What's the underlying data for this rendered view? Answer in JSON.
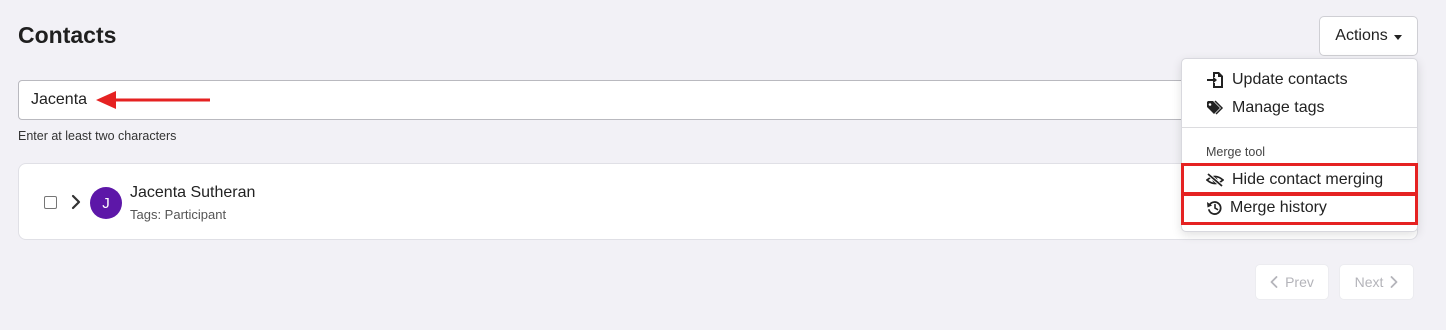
{
  "page": {
    "title": "Contacts"
  },
  "actions": {
    "label": "Actions"
  },
  "search": {
    "value": "Jacenta",
    "hint": "Enter at least two characters"
  },
  "results": [
    {
      "initial": "J",
      "name": "Jacenta Sutheran",
      "tags": "Tags: Participant"
    }
  ],
  "pagination": {
    "prev": "Prev",
    "next": "Next"
  },
  "dropdown": {
    "items": [
      {
        "label": "Update contacts",
        "icon": "file-import-icon"
      },
      {
        "label": "Manage tags",
        "icon": "tags-icon"
      }
    ],
    "merge_header": "Merge tool",
    "merge_items": [
      {
        "label": "Hide contact merging",
        "icon": "eye-slash-icon"
      },
      {
        "label": "Merge history",
        "icon": "history-icon"
      }
    ]
  },
  "colors": {
    "annotation": "#e52222",
    "avatar": "#5d17a8",
    "background": "#f2f1f6"
  }
}
